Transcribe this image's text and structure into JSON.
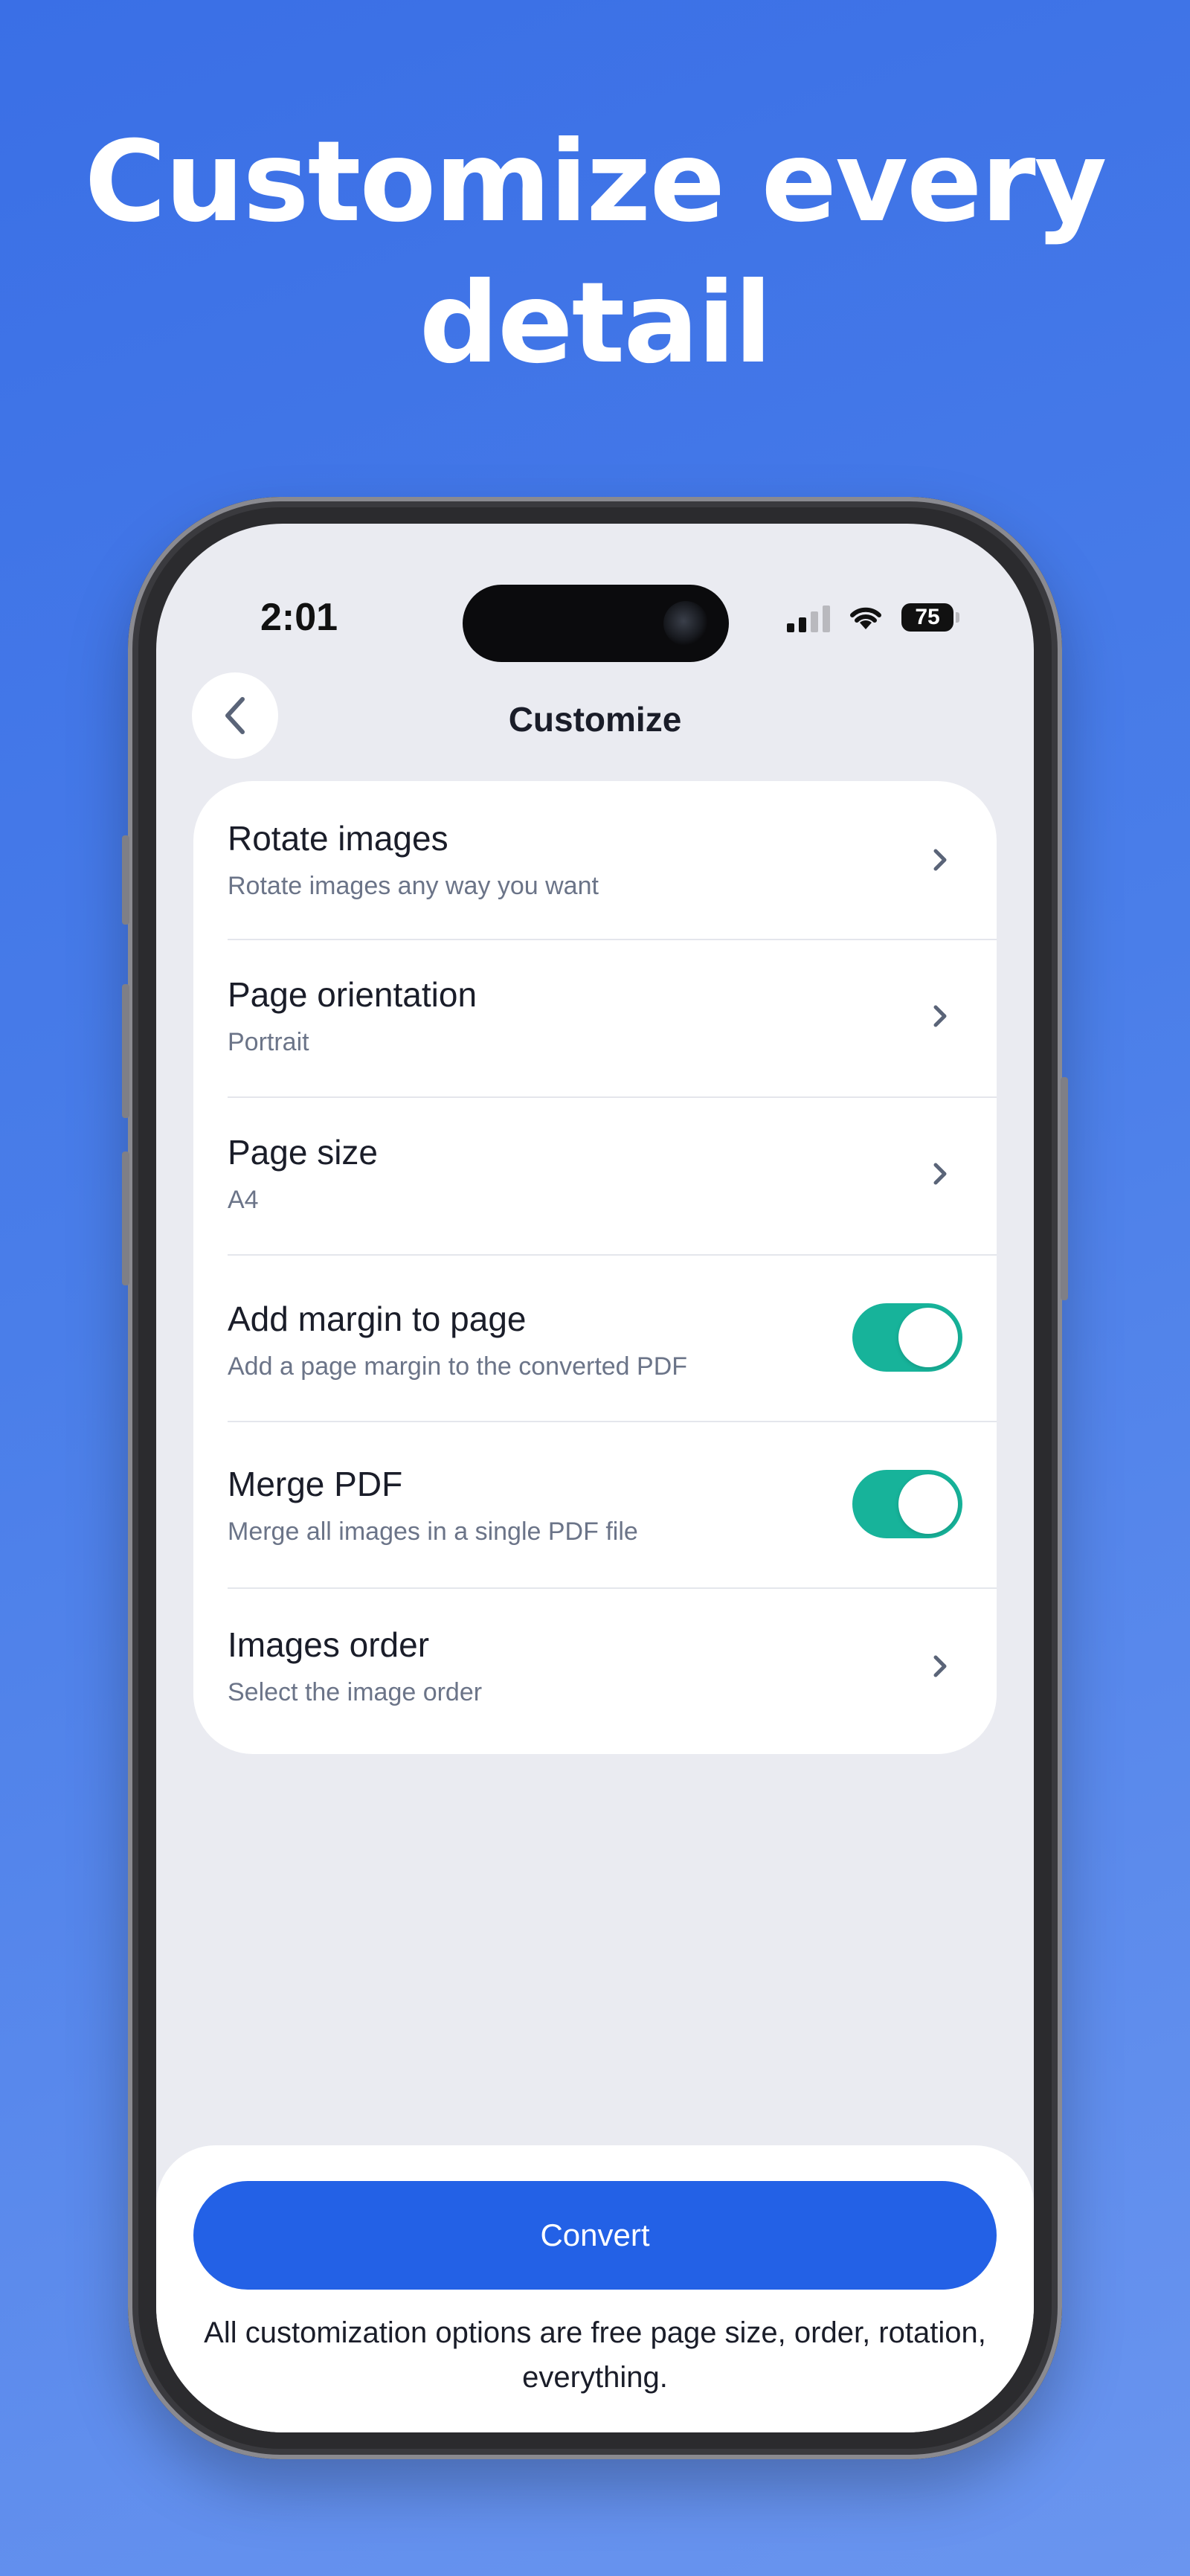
{
  "headline": {
    "line1": "Customize every",
    "line2": "detail"
  },
  "status_bar": {
    "time": "2:01",
    "battery": "75"
  },
  "nav": {
    "title": "Customize",
    "back_icon": "chevron-left-icon"
  },
  "settings": [
    {
      "title": "Rotate images",
      "subtitle": "Rotate images any way you want",
      "control": "chevron"
    },
    {
      "title": "Page orientation",
      "subtitle": "Portrait",
      "control": "chevron"
    },
    {
      "title": "Page size",
      "subtitle": "A4",
      "control": "chevron"
    },
    {
      "title": "Add margin to page",
      "subtitle": "Add a page margin to the converted PDF",
      "control": "toggle",
      "on": true
    },
    {
      "title": "Merge PDF",
      "subtitle": "Merge all images in a single PDF file",
      "control": "toggle",
      "on": true
    },
    {
      "title": "Images order",
      "subtitle": "Select the image order",
      "control": "chevron"
    }
  ],
  "bottom": {
    "convert_label": "Convert",
    "note": "All customization options are free page size, order, rotation, everything."
  },
  "colors": {
    "background": "#3a6fe6",
    "accent": "#2361e6",
    "toggle_on": "#17b39a"
  }
}
